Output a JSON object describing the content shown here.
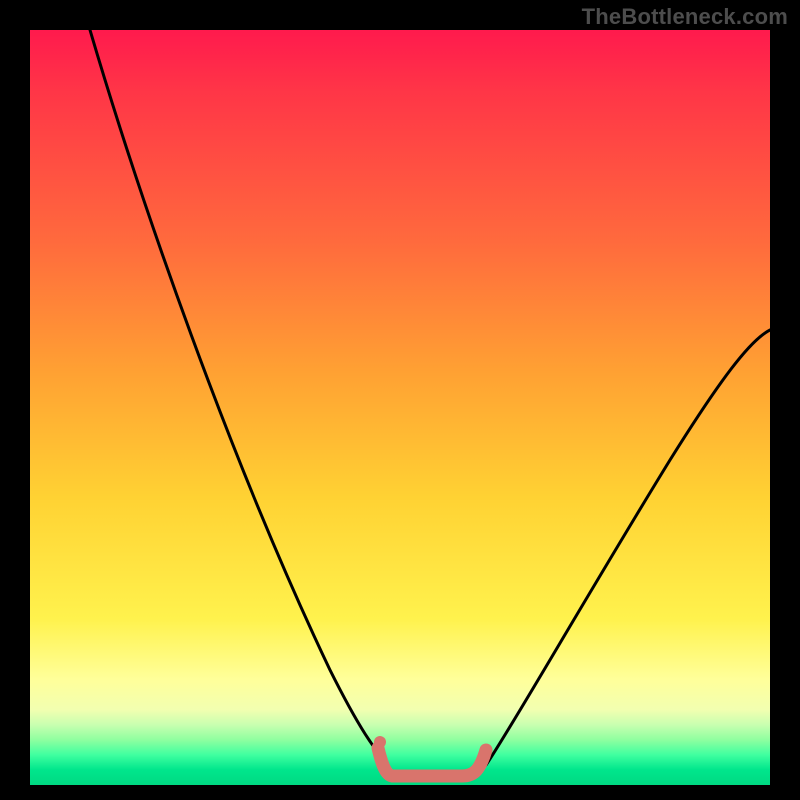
{
  "watermark": "TheBottleneck.com",
  "chart_data": {
    "type": "line",
    "title": "",
    "xlabel": "",
    "ylabel": "",
    "xlim": [
      0,
      100
    ],
    "ylim": [
      0,
      100
    ],
    "grid": false,
    "series": [
      {
        "name": "left-curve",
        "color": "#000000",
        "x": [
          8,
          14,
          20,
          26,
          32,
          38,
          44,
          48
        ],
        "y": [
          100,
          81,
          63,
          46,
          31,
          18,
          8,
          3
        ]
      },
      {
        "name": "right-curve",
        "color": "#000000",
        "x": [
          62,
          68,
          74,
          80,
          86,
          92,
          100
        ],
        "y": [
          3,
          8,
          16,
          25,
          35,
          46,
          60
        ]
      },
      {
        "name": "bottom-squiggle",
        "color": "#d9746c",
        "x": [
          47,
          48,
          49,
          50,
          52,
          55,
          58,
          60,
          62,
          63
        ],
        "y": [
          5,
          2,
          1,
          1,
          1,
          1,
          1,
          1,
          2,
          5
        ]
      }
    ],
    "gradient_stops": [
      {
        "pos": 0,
        "color": "#ff1a4d"
      },
      {
        "pos": 28,
        "color": "#ff6a3d"
      },
      {
        "pos": 62,
        "color": "#ffd233"
      },
      {
        "pos": 86,
        "color": "#ffff9a"
      },
      {
        "pos": 100,
        "color": "#00d982"
      }
    ]
  }
}
